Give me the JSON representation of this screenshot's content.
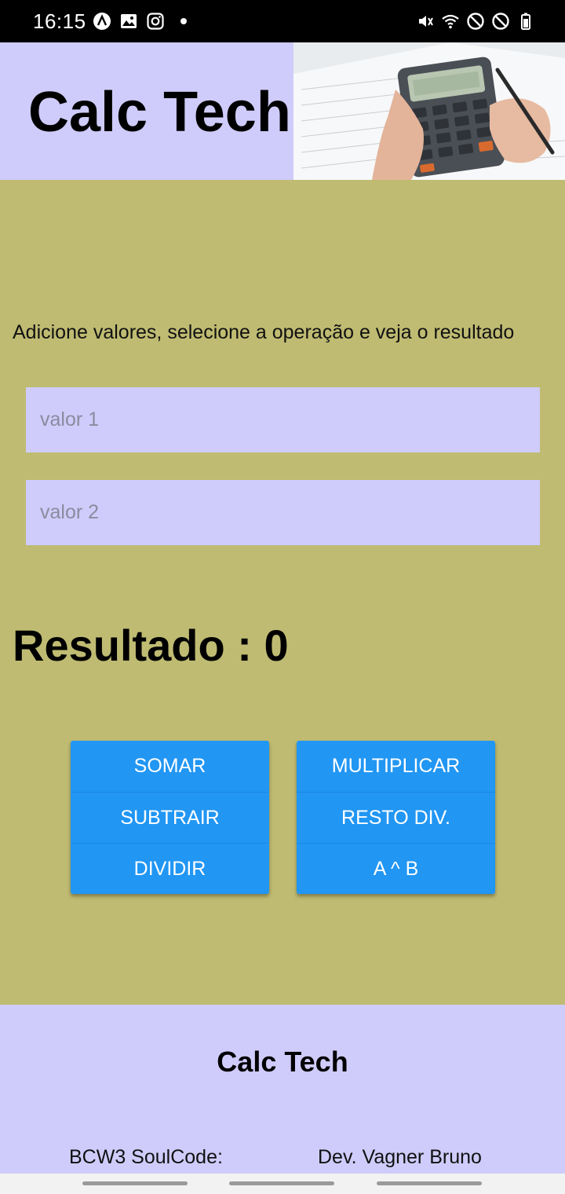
{
  "status_bar": {
    "time": "16:15",
    "left_icons": [
      "app-a-icon",
      "gallery-icon",
      "instagram-icon",
      "notification-dot"
    ],
    "right_icons": [
      "mute-icon",
      "wifi-icon",
      "do-not-disturb-icon",
      "do-not-disturb-icon",
      "battery-icon"
    ]
  },
  "header": {
    "title": "Calc Tech",
    "image": "calculator-photo"
  },
  "main": {
    "instructions": "Adicione valores, selecione a operação e veja o resultado",
    "input1": {
      "placeholder": "valor 1",
      "value": ""
    },
    "input2": {
      "placeholder": "valor 2",
      "value": ""
    },
    "result_label": "Resultado : ",
    "result_value": "0",
    "buttons_left": [
      "SOMAR",
      "SUBTRAIR",
      "DIVIDIR"
    ],
    "buttons_right": [
      "MULTIPLICAR",
      "RESTO DIV.",
      "A ^ B"
    ]
  },
  "footer": {
    "title": "Calc Tech",
    "left_text": "BCW3 SoulCode:",
    "right_text": "Dev. Vagner Bruno"
  },
  "colors": {
    "header_bg": "#cfccfb",
    "main_bg": "#bfbb72",
    "button_bg": "#2196f3",
    "footer_bg": "#cfccfb"
  }
}
